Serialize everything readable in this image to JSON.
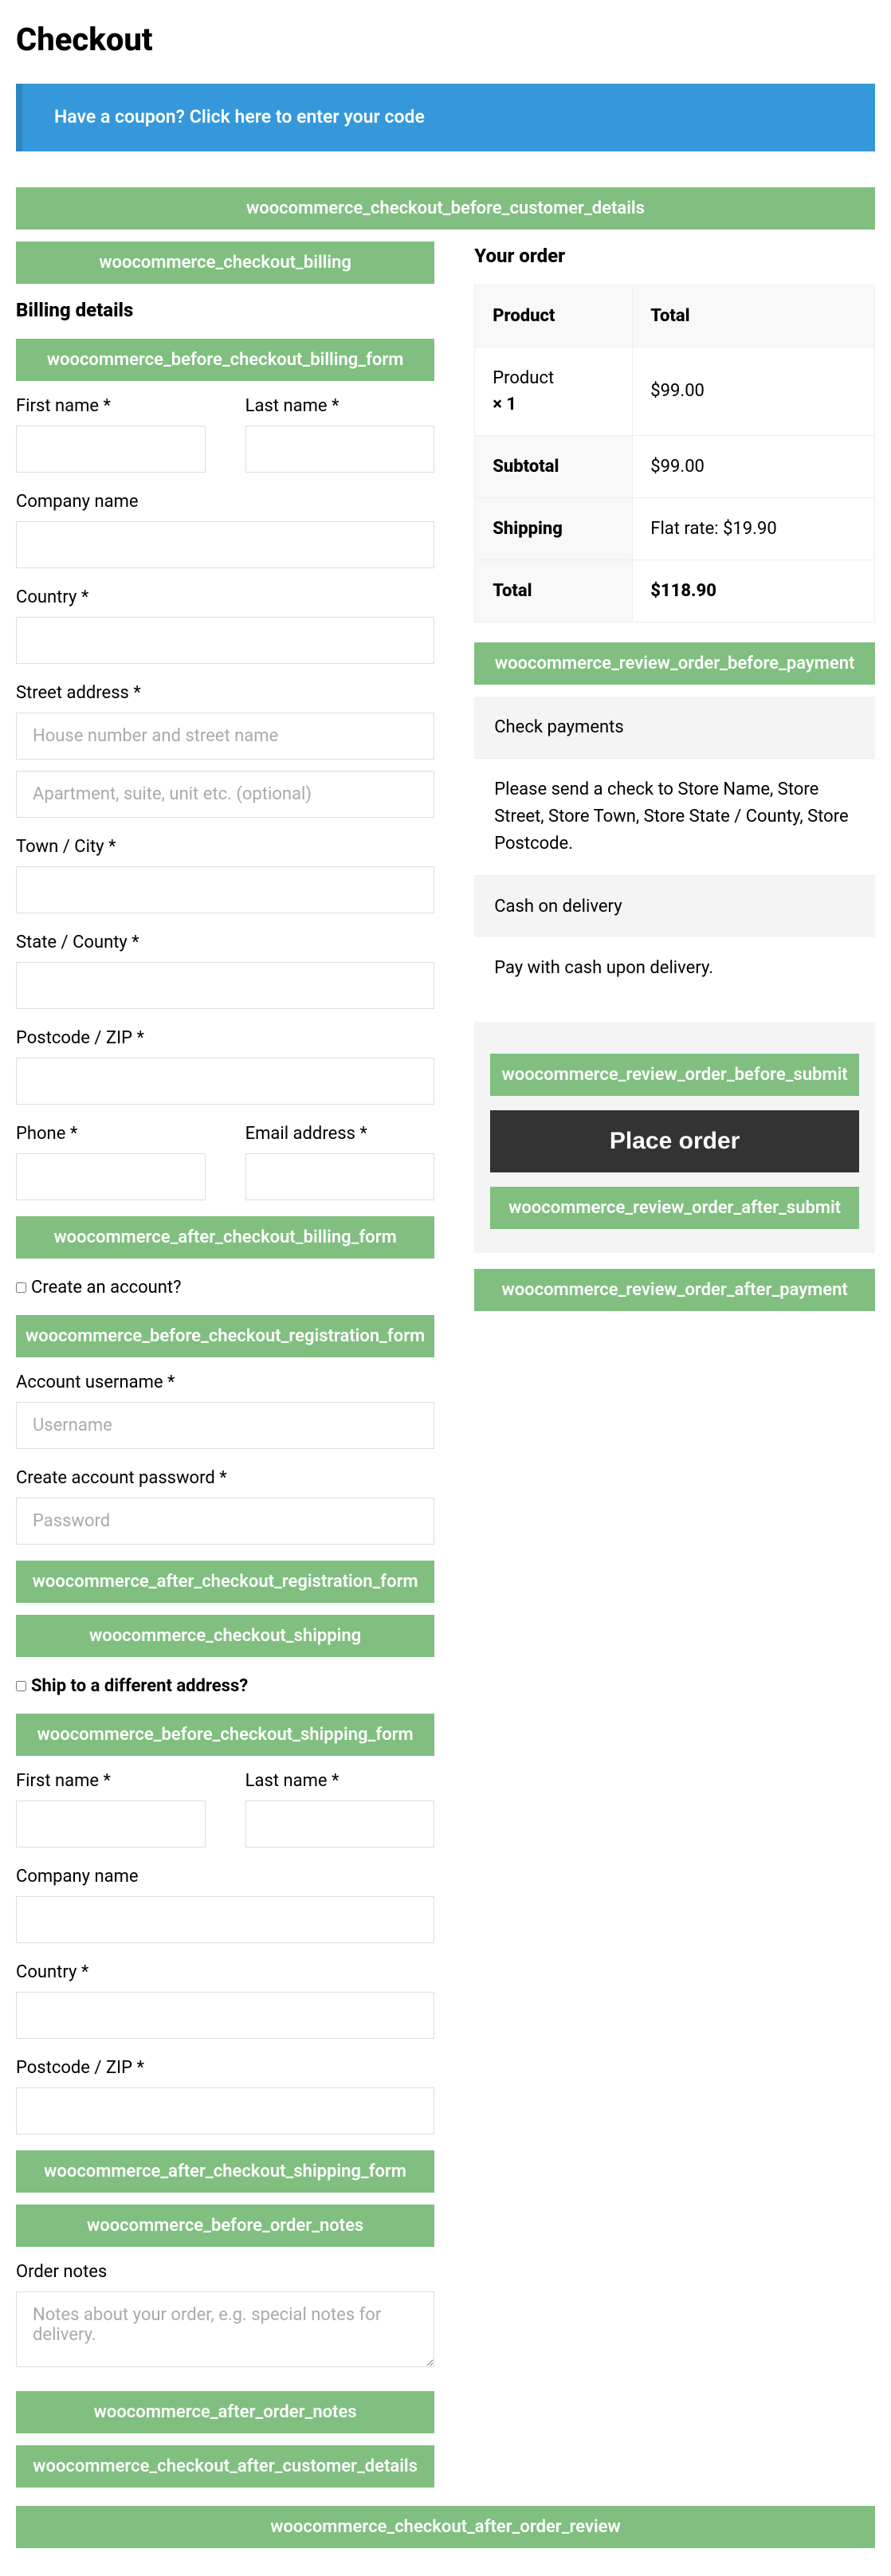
{
  "page_title": "Checkout",
  "coupon_banner": "Have a coupon? Click here to enter your code",
  "hooks": {
    "before_customer_details": "woocommerce_checkout_before_customer_details",
    "checkout_billing": "woocommerce_checkout_billing",
    "before_billing_form": "woocommerce_before_checkout_billing_form",
    "after_billing_form": "woocommerce_after_checkout_billing_form",
    "before_registration_form": "woocommerce_before_checkout_registration_form",
    "after_registration_form": "woocommerce_after_checkout_registration_form",
    "checkout_shipping": "woocommerce_checkout_shipping",
    "before_shipping_form": "woocommerce_before_checkout_shipping_form",
    "after_shipping_form": "woocommerce_after_checkout_shipping_form",
    "before_order_notes": "woocommerce_before_order_notes",
    "after_order_notes": "woocommerce_after_order_notes",
    "after_customer_details": "woocommerce_checkout_after_customer_details",
    "after_order_review": "woocommerce_checkout_after_order_review",
    "review_before_payment": "woocommerce_review_order_before_payment",
    "review_before_submit": "woocommerce_review_order_before_submit",
    "review_after_submit": "woocommerce_review_order_after_submit",
    "review_after_payment": "woocommerce_review_order_after_payment"
  },
  "billing": {
    "heading": "Billing details",
    "first_name": "First name *",
    "last_name": "Last name *",
    "company": "Company name",
    "country": "Country *",
    "street": "Street address *",
    "street_ph1": "House number and street name",
    "street_ph2": "Apartment, suite, unit etc. (optional)",
    "city": "Town / City *",
    "state": "State / County *",
    "postcode": "Postcode / ZIP *",
    "phone": "Phone *",
    "email": "Email address *"
  },
  "account": {
    "create_label": "Create an account?",
    "username_label": "Account username *",
    "username_ph": "Username",
    "password_label": "Create account password *",
    "password_ph": "Password"
  },
  "shipping": {
    "toggle_label": "Ship to a different address?",
    "first_name": "First name *",
    "last_name": "Last name *",
    "company": "Company name",
    "country": "Country *",
    "postcode": "Postcode / ZIP *"
  },
  "notes": {
    "label": "Order notes",
    "placeholder": "Notes about your order, e.g. special notes for delivery."
  },
  "order": {
    "heading": "Your order",
    "col_product": "Product",
    "col_total": "Total",
    "product_name": "Product",
    "product_qty": "× 1",
    "product_price": "$99.00",
    "subtotal_label": "Subtotal",
    "subtotal_value": "$99.00",
    "shipping_label": "Shipping",
    "shipping_value": "Flat rate: $19.90",
    "total_label": "Total",
    "total_value": "$118.90"
  },
  "payment": {
    "check_title": "Check payments",
    "check_desc": "Please send a check to Store Name, Store Street, Store Town, Store State / County, Store Postcode.",
    "cod_title": "Cash on delivery",
    "cod_desc": "Pay with cash upon delivery."
  },
  "place_order": "Place order"
}
